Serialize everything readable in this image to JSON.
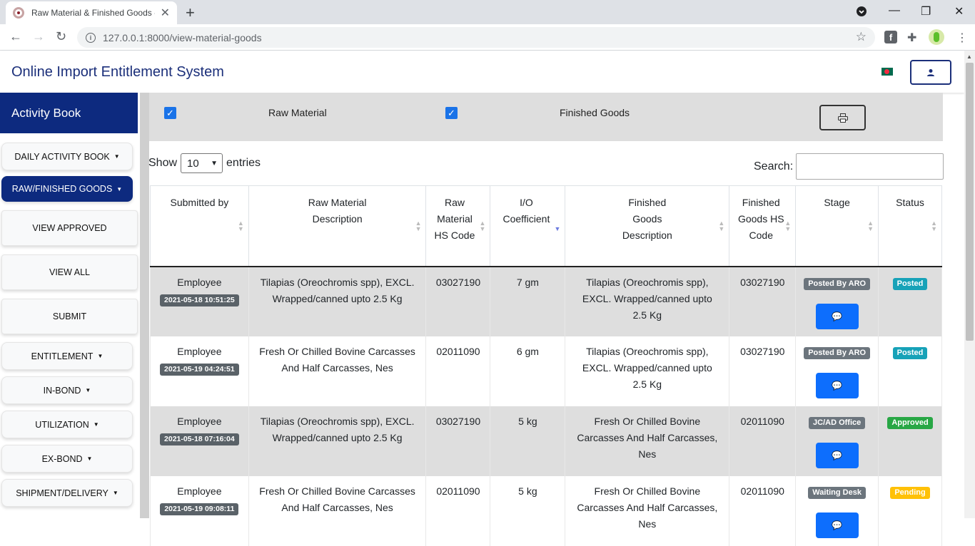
{
  "browser": {
    "tab_title": "Raw Material & Finished Goods - ...",
    "url": "127.0.0.1:8000/view-material-goods"
  },
  "header": {
    "app_title": "Online Import Entitlement System"
  },
  "sidebar": {
    "title": "Activity Book",
    "items": [
      {
        "label": "DAILY ACTIVITY BOOK"
      },
      {
        "label": "RAW/FINISHED GOODS"
      },
      {
        "label": "VIEW APPROVED"
      },
      {
        "label": "VIEW ALL"
      },
      {
        "label": "SUBMIT"
      },
      {
        "label": "ENTITLEMENT"
      },
      {
        "label": "IN-BOND"
      },
      {
        "label": "UTILIZATION"
      },
      {
        "label": "EX-BOND"
      },
      {
        "label": "SHIPMENT/DELIVERY"
      }
    ]
  },
  "filters": {
    "raw_material_label": "Raw Material",
    "finished_goods_label": "Finished Goods"
  },
  "table_controls": {
    "show_label": "Show",
    "entries_value": "10",
    "entries_label": "entries",
    "search_label": "Search:",
    "search_value": ""
  },
  "table": {
    "headers": [
      "Submitted by",
      "Raw Material Description",
      "Raw Material HS Code",
      "I/O Coefficient",
      "Finished Goods Description",
      "Finished Goods HS Code",
      "Stage",
      "Status"
    ],
    "rows": [
      {
        "submitted_by": "Employee",
        "date": "2021-05-18 10:51:25",
        "raw_desc": "Tilapias (Oreochromis spp), EXCL. Wrapped/canned upto 2.5 Kg",
        "raw_hs": "03027190",
        "io": "7 gm",
        "fg_desc": "Tilapias (Oreochromis spp), EXCL. Wrapped/canned upto 2.5 Kg",
        "fg_hs": "03027190",
        "stage": "Posted By ARO",
        "status": "Posted"
      },
      {
        "submitted_by": "Employee",
        "date": "2021-05-19 04:24:51",
        "raw_desc": "Fresh Or Chilled Bovine Carcasses And Half Carcasses, Nes",
        "raw_hs": "02011090",
        "io": "6 gm",
        "fg_desc": "Tilapias (Oreochromis spp), EXCL. Wrapped/canned upto 2.5 Kg",
        "fg_hs": "03027190",
        "stage": "Posted By ARO",
        "status": "Posted"
      },
      {
        "submitted_by": "Employee",
        "date": "2021-05-18 07:16:04",
        "raw_desc": "Tilapias (Oreochromis spp), EXCL. Wrapped/canned upto 2.5 Kg",
        "raw_hs": "03027190",
        "io": "5 kg",
        "fg_desc": "Fresh Or Chilled Bovine Carcasses And Half Carcasses, Nes",
        "fg_hs": "02011090",
        "stage": "JC/AD Office",
        "status": "Approved"
      },
      {
        "submitted_by": "Employee",
        "date": "2021-05-19 09:08:11",
        "raw_desc": "Fresh Or Chilled Bovine Carcasses And Half Carcasses, Nes",
        "raw_hs": "02011090",
        "io": "5 kg",
        "fg_desc": "Fresh Or Chilled Bovine Carcasses And Half Carcasses, Nes",
        "fg_hs": "02011090",
        "stage": "Waiting Desk",
        "status": "Pending"
      }
    ]
  },
  "colors": {
    "brand_navy": "#0d2a7f",
    "posted": "#17a2b8",
    "approved": "#28a745",
    "pending": "#ffc107"
  }
}
